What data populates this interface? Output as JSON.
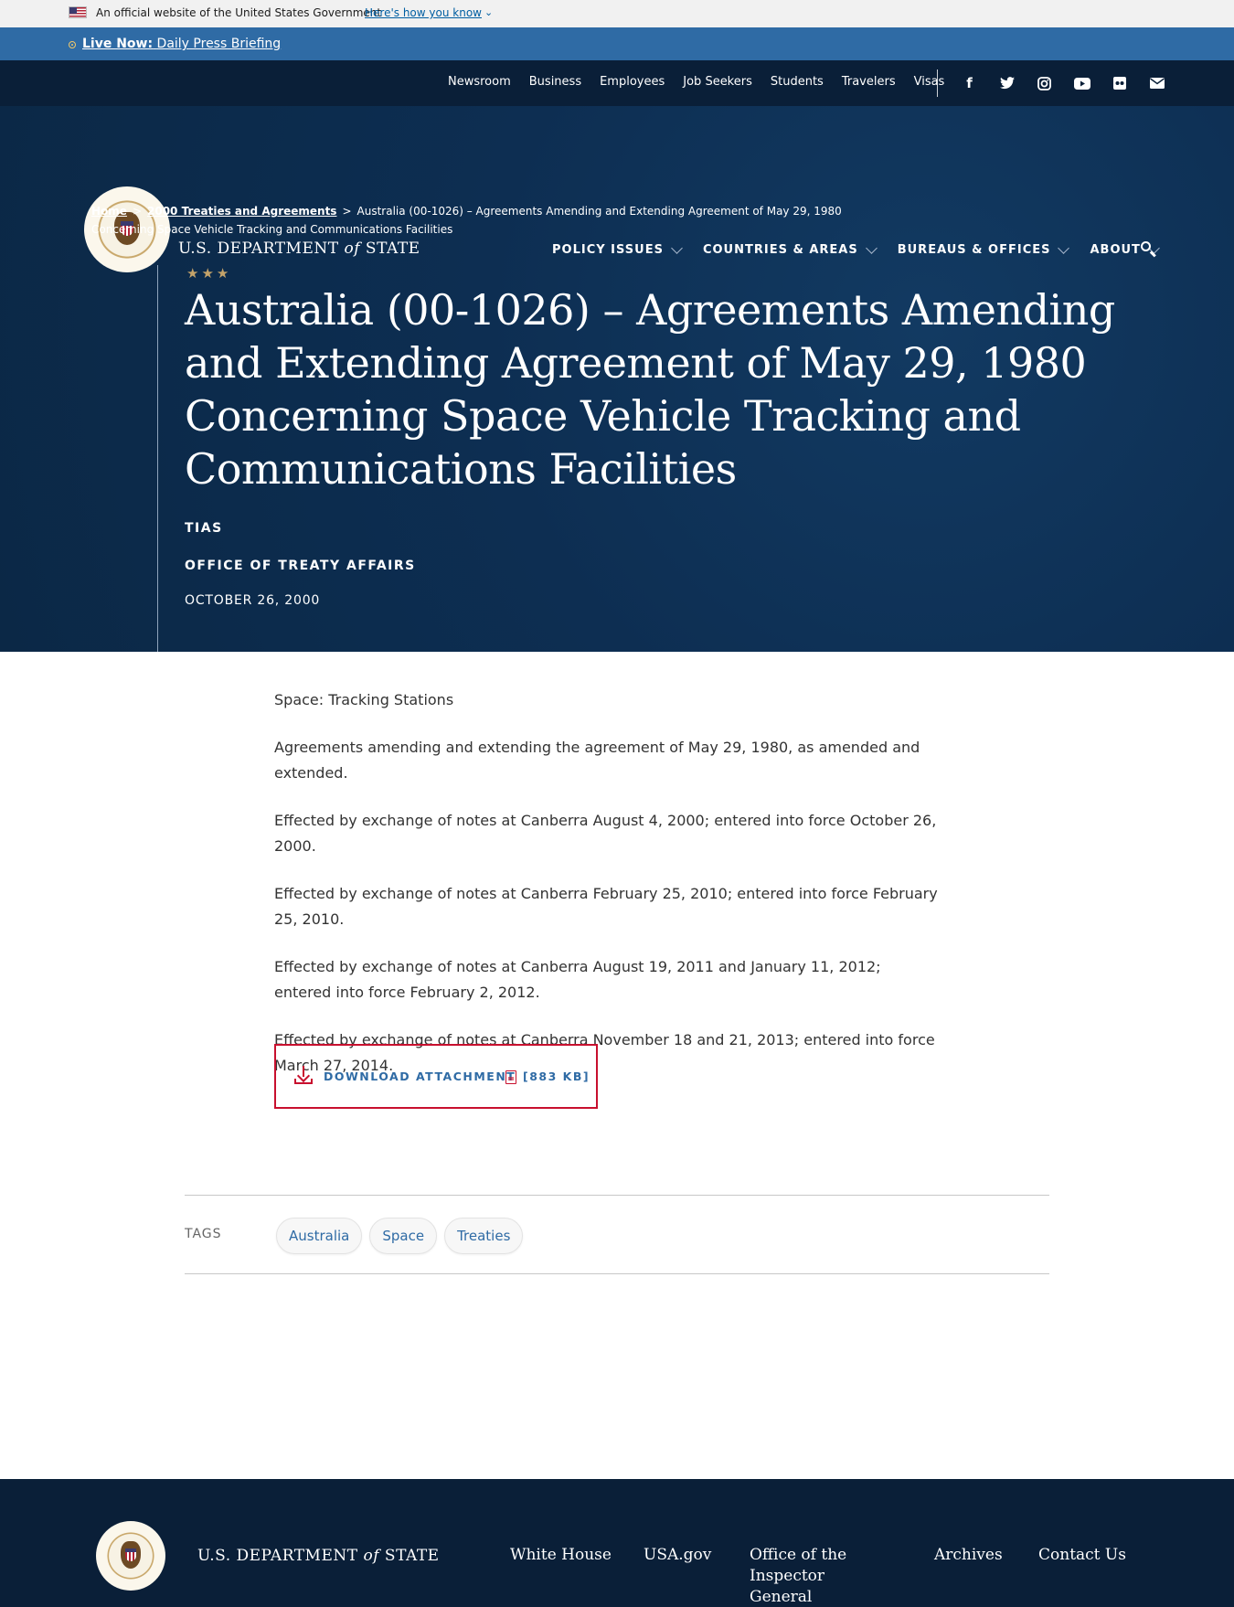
{
  "gov_banner": {
    "text": "An official website of the United States Government",
    "link": "Here's how you know"
  },
  "live_bar": {
    "label": "Live Now:",
    "text": "Daily Press Briefing"
  },
  "utility_nav": [
    "Newsroom",
    "Business",
    "Employees",
    "Job Seekers",
    "Students",
    "Travelers",
    "Visas"
  ],
  "social_icons": [
    "facebook-icon",
    "twitter-icon",
    "instagram-icon",
    "youtube-icon",
    "flickr-icon",
    "email-icon"
  ],
  "header": {
    "brand_pre": "U.S. DEPARTMENT ",
    "brand_of": "of",
    "brand_post": " STATE",
    "nav": [
      "POLICY ISSUES",
      "COUNTRIES & AREAS",
      "BUREAUS & OFFICES",
      "ABOUT"
    ]
  },
  "breadcrumb": {
    "home": "Home",
    "section": "2000 Treaties and Agreements",
    "current": "Australia (00-1026) – Agreements Amending and Extending Agreement of May 29, 1980 Concerning Space Vehicle Tracking and Communications Facilities",
    "sep": ">"
  },
  "hero": {
    "stars": "★★★",
    "title": "Australia (00-1026) – Agreements Amending and Extending Agreement of May 29, 1980 Concerning Space Vehicle Tracking and Communications Facilities",
    "category": "TIAS",
    "office": "OFFICE OF TREATY AFFAIRS",
    "date": "OCTOBER 26, 2000"
  },
  "content": {
    "paragraphs": [
      "Space: Tracking Stations",
      "Agreements amending and extending the agreement of May 29, 1980, as amended and extended.",
      "Effected by exchange of notes at Canberra August 4, 2000; entered into force October 26, 2000.",
      "Effected by exchange of notes at Canberra February 25, 2010; entered into force February 25, 2010.",
      "Effected by exchange of notes at Canberra August 19, 2011 and January 11, 2012; entered into force February 2, 2012.",
      "Effected by exchange of notes at Canberra November 18 and 21, 2013; entered into force March 27, 2014."
    ],
    "download_label": "DOWNLOAD ATTACHMENT",
    "download_size": "[883 KB]"
  },
  "tags": {
    "label": "TAGS",
    "items": [
      "Australia",
      "Space",
      "Treaties"
    ]
  },
  "footer": {
    "brand_pre": "U.S. DEPARTMENT ",
    "brand_of": "of",
    "brand_post": " STATE",
    "links": [
      "White House",
      "USA.gov",
      "Office of the Inspector General",
      "Archives",
      "Contact Us"
    ]
  },
  "colors": {
    "navy": "#0b2846",
    "utility": "#0a1f38",
    "live_blue": "#2f6ba5",
    "accent_red": "#c8102e",
    "gold": "#c4a36a"
  }
}
